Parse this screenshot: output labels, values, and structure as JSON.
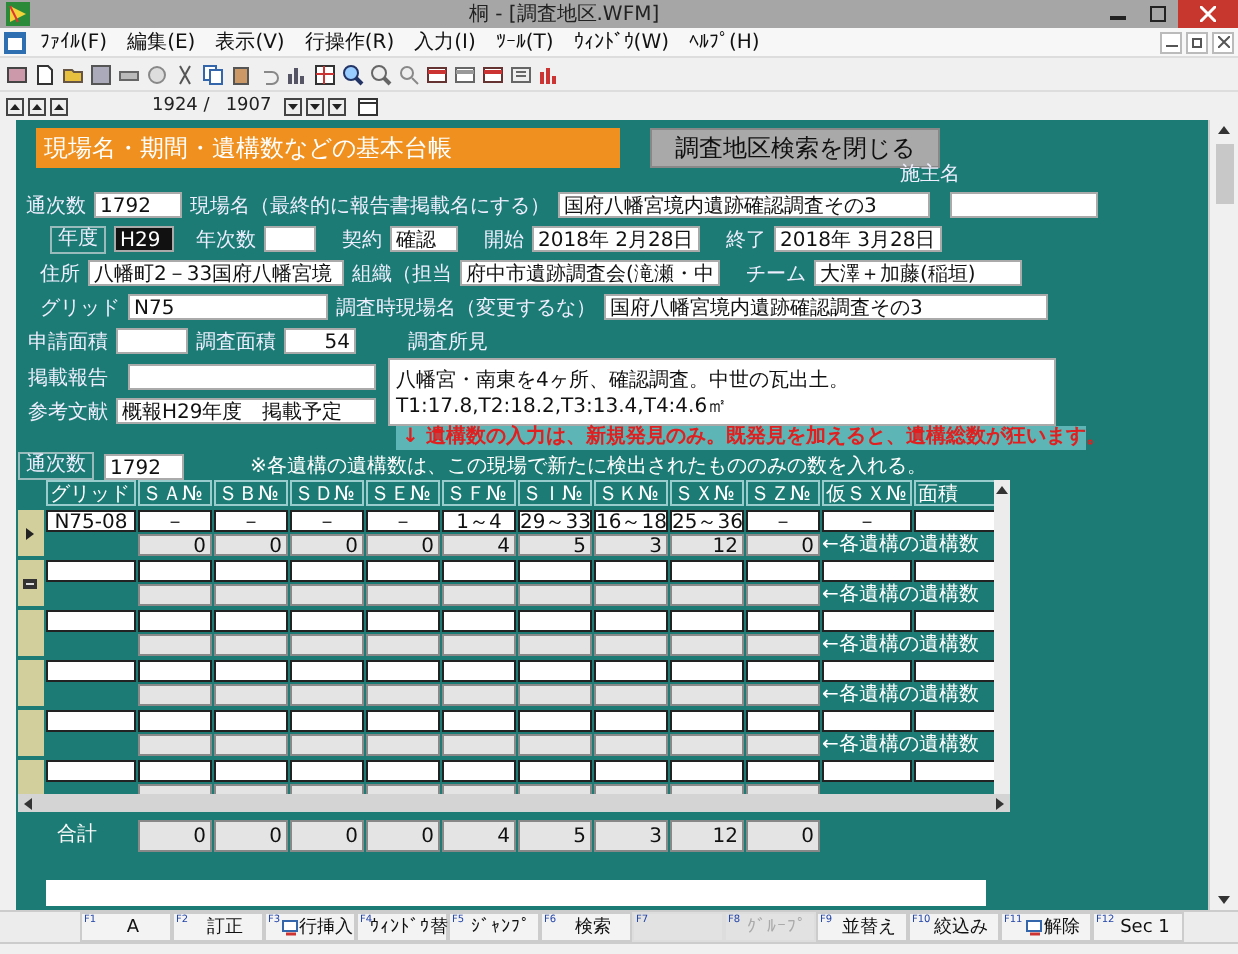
{
  "window": {
    "title": "桐 - [調査地区.WFM]"
  },
  "menu": [
    "ﾌｧｲﾙ(F)",
    "編集(E)",
    "表示(V)",
    "行操作(R)",
    "入力(I)",
    "ﾂｰﾙ(T)",
    "ｳｨﾝﾄﾞｳ(W)",
    "ﾍﾙﾌﾟ(H)"
  ],
  "navigator": {
    "current": "1924 /",
    "total": "1907"
  },
  "form": {
    "header": "現場名・期間・遺構数などの基本台帳",
    "close_search_button": "調査地区検索を閉じる",
    "serial": {
      "label": "通次数",
      "value": "1792"
    },
    "site_name": {
      "label": "現場名（最終的に報告書掲載名にする）",
      "value": "国府八幡宮境内遺跡確認調査その3"
    },
    "client": {
      "label": "施主名"
    },
    "fiscal_year": {
      "label": "年度",
      "value": "H29"
    },
    "year_count": {
      "label": "年次数"
    },
    "contract": {
      "label": "契約",
      "value": "確認"
    },
    "start": {
      "label": "開始",
      "value": "2018年 2月28日"
    },
    "end": {
      "label": "終了",
      "value": "2018年 3月28日"
    },
    "address": {
      "label": "住所",
      "value": "八幡町2－33国府八幡宮境"
    },
    "organization": {
      "label": "組織（担当",
      "value": "府中市遺跡調査会(滝瀬・中"
    },
    "team": {
      "label": "チーム",
      "value": "大澤＋加藤(稲垣)"
    },
    "grid": {
      "label": "グリッド",
      "value": "N75"
    },
    "survey_site_name": {
      "label": "調査時現場名（変更するな）",
      "value": "国府八幡宮境内遺跡確認調査その3"
    },
    "applied_area": {
      "label": "申請面積"
    },
    "surveyed_area": {
      "label": "調査面積",
      "value": "54"
    },
    "findings": {
      "label": "調査所見",
      "value": "八幡宮・南東を4ヶ所、確認調査。中世の瓦出土。T1:17.8,T2:18.2,T3:13.4,T4:4.6㎡"
    },
    "publication": {
      "label": "掲載報告"
    },
    "references": {
      "label": "参考文献",
      "value": "概報H29年度　掲載予定"
    },
    "notice": "↓ 遺構数の入力は、新規発見のみ。既発見を加えると、遺構総数が狂います。"
  },
  "subform": {
    "serial": {
      "label": "通次数",
      "value": "1792"
    },
    "note": "※各遺構の遺構数は、この現場で新たに検出されたもののみの数を入れる。",
    "columns": [
      "グリッド",
      "ＳＡ№",
      "ＳＢ№",
      "ＳＤ№",
      "ＳＥ№",
      "ＳＦ№",
      "ＳＩ№",
      "ＳＫ№",
      "ＳＸ№",
      "ＳＺ№",
      "仮ＳＸ№",
      "面積"
    ],
    "records": [
      {
        "kind": "data",
        "selected": true,
        "grid": "N75-08",
        "cells": [
          "－",
          "－",
          "－",
          "－",
          "1～4",
          "29～33",
          "16～18",
          "25～36",
          "－",
          "－"
        ],
        "counts": [
          "0",
          "0",
          "0",
          "0",
          "4",
          "5",
          "3",
          "12",
          "0"
        ],
        "count_label": "←各遺構の遺構数"
      },
      {
        "kind": "new",
        "selected": false,
        "count_label": "←各遺構の遺構数"
      },
      {
        "kind": "blank",
        "selected": false,
        "count_label": "←各遺構の遺構数"
      },
      {
        "kind": "blank",
        "selected": false,
        "count_label": "←各遺構の遺構数"
      },
      {
        "kind": "blank",
        "selected": false,
        "count_label": "←各遺構の遺構数"
      },
      {
        "kind": "blank",
        "selected": false
      }
    ],
    "totals": {
      "label": "合計",
      "values": [
        "0",
        "0",
        "0",
        "0",
        "4",
        "5",
        "3",
        "12",
        "0"
      ]
    }
  },
  "function_keys": [
    {
      "key": "F1",
      "label": "A",
      "disabled": false,
      "icon": false
    },
    {
      "key": "F2",
      "label": "訂正",
      "disabled": false,
      "icon": false
    },
    {
      "key": "F3",
      "label": "行挿入",
      "disabled": false,
      "icon": true
    },
    {
      "key": "F4",
      "label": "ｳｨﾝﾄﾞｳ替",
      "disabled": false,
      "icon": false
    },
    {
      "key": "F5",
      "label": "ｼﾞｬﾝﾌﾟ",
      "disabled": false,
      "icon": false
    },
    {
      "key": "F6",
      "label": "検索",
      "disabled": false,
      "icon": false
    },
    {
      "key": "F7",
      "disabled": true,
      "icon": false
    },
    {
      "key": "F8",
      "label": "ｸﾞﾙｰﾌﾟ",
      "disabled": true,
      "icon": false
    },
    {
      "key": "F9",
      "label": "並替え",
      "disabled": false,
      "icon": false
    },
    {
      "key": "F10",
      "label": "絞込み",
      "disabled": false,
      "icon": false
    },
    {
      "key": "F11",
      "label": "解除",
      "disabled": false,
      "icon": true
    },
    {
      "key": "F12",
      "label": "Sec 1",
      "disabled": false,
      "icon": false
    }
  ]
}
